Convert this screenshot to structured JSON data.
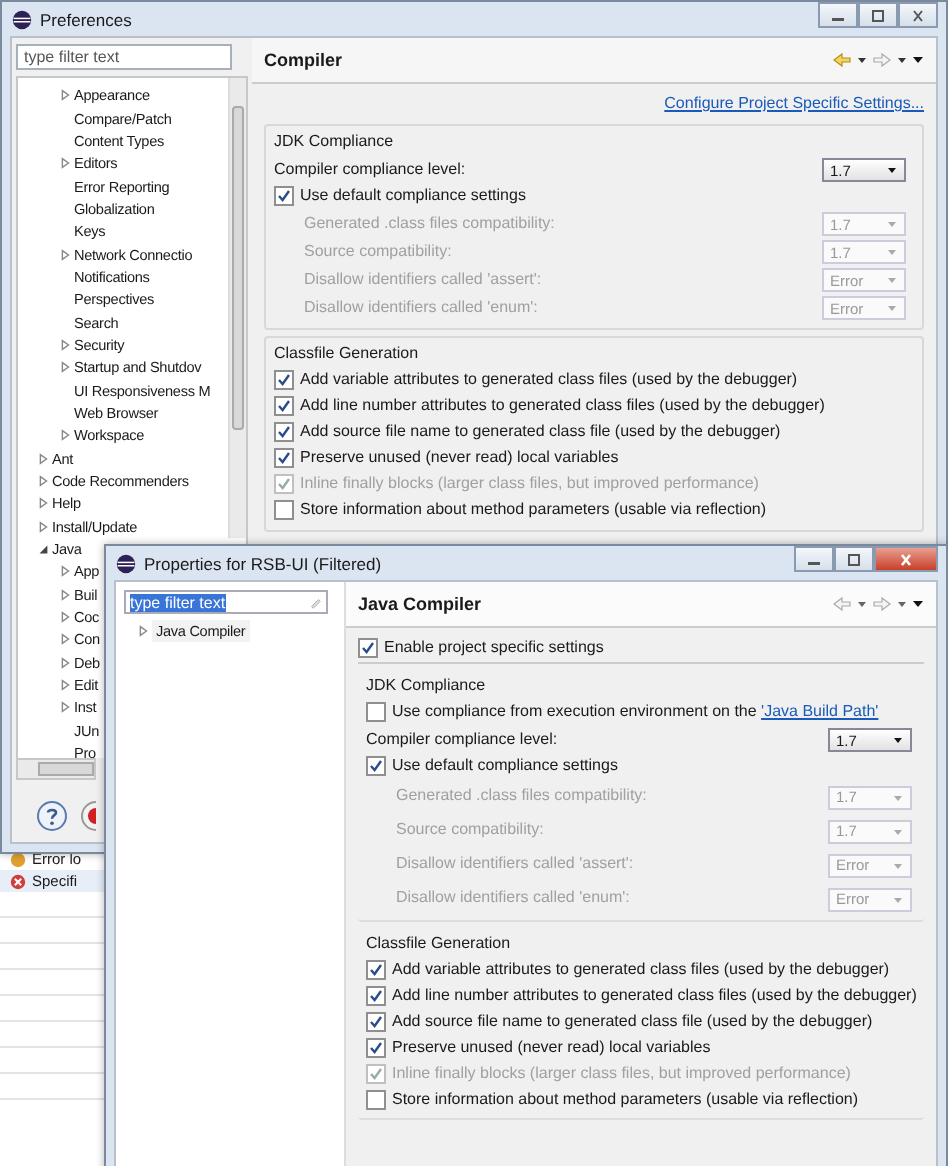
{
  "preferences": {
    "title": "Preferences",
    "filter": {
      "placeholder": "type filter text"
    },
    "tree": [
      {
        "children": [
          {
            "label": "Appearance",
            "expanded": false
          },
          {
            "label": "Compare/Patch"
          },
          {
            "label": "Content Types"
          },
          {
            "label": "Editors",
            "expanded": false
          },
          {
            "label": "Error Reporting"
          },
          {
            "label": "Globalization"
          },
          {
            "label": "Keys"
          },
          {
            "label": "Network Connectio",
            "expanded": false
          },
          {
            "label": "Notifications"
          },
          {
            "label": "Perspectives"
          },
          {
            "label": "Search"
          },
          {
            "label": "Security",
            "expanded": false
          },
          {
            "label": "Startup and Shutdov",
            "expanded": false
          },
          {
            "label": "UI Responsiveness M"
          },
          {
            "label": "Web Browser"
          },
          {
            "label": "Workspace",
            "expanded": false
          }
        ]
      },
      {
        "label": "Ant",
        "expanded": false
      },
      {
        "label": "Code Recommenders",
        "expanded": false
      },
      {
        "label": "Help",
        "expanded": false
      },
      {
        "label": "Install/Update",
        "expanded": false
      },
      {
        "label": "Java",
        "expanded": true,
        "children": [
          {
            "label": "App",
            "expanded": false
          },
          {
            "label": "Buil",
            "expanded": false
          },
          {
            "label": "Coc",
            "expanded": false
          },
          {
            "label": "Con",
            "expanded": false
          },
          {
            "label": "Deb",
            "expanded": false
          },
          {
            "label": "Edit",
            "expanded": false
          },
          {
            "label": "Inst",
            "expanded": false
          },
          {
            "label": "JUn"
          },
          {
            "label": "Pro"
          }
        ]
      }
    ],
    "page": {
      "title": "Compiler",
      "link": "Configure Project Specific Settings...",
      "jdk": {
        "heading": "JDK Compliance",
        "level_label": "Compiler compliance level:",
        "level_value": "1.7",
        "use_default": {
          "label": "Use default compliance settings",
          "checked": true
        },
        "rows": [
          {
            "label": "Generated .class files compatibility:",
            "value": "1.7",
            "disabled": true
          },
          {
            "label": "Source compatibility:",
            "value": "1.7",
            "disabled": true
          },
          {
            "label": "Disallow identifiers called 'assert':",
            "value": "Error",
            "disabled": true
          },
          {
            "label": "Disallow identifiers called 'enum':",
            "value": "Error",
            "disabled": true
          }
        ]
      },
      "classfile": {
        "heading": "Classfile Generation",
        "options": [
          {
            "label": "Add variable attributes to generated class files (used by the debugger)",
            "checked": true,
            "disabled": false
          },
          {
            "label": "Add line number attributes to generated class files (used by the debugger)",
            "checked": true,
            "disabled": false
          },
          {
            "label": "Add source file name to generated class file (used by the debugger)",
            "checked": true,
            "disabled": false
          },
          {
            "label": "Preserve unused (never read) local variables",
            "checked": true,
            "disabled": false
          },
          {
            "label": "Inline finally blocks (larger class files, but improved performance)",
            "checked": true,
            "disabled": true
          },
          {
            "label": "Store information about method parameters (usable via reflection)",
            "checked": false,
            "disabled": false
          }
        ]
      }
    }
  },
  "background_view": {
    "rows": [
      {
        "label": "Error lo",
        "kind": "warning"
      },
      {
        "label": "Specifi",
        "kind": "error"
      }
    ]
  },
  "properties": {
    "title": "Properties for RSB-UI (Filtered)",
    "filter": {
      "value": "type filter text",
      "text_selected": true
    },
    "tree": [
      {
        "label": "Java Compiler",
        "expanded": false
      }
    ],
    "page": {
      "title": "Java Compiler",
      "enable": {
        "label": "Enable project specific settings",
        "checked": true
      },
      "jdk": {
        "heading": "JDK Compliance",
        "use_ee": {
          "label": "Use compliance from execution environment on the ",
          "link": "'Java Build Path'",
          "checked": false
        },
        "level_label": "Compiler compliance level:",
        "level_value": "1.7",
        "use_default": {
          "label": "Use default compliance settings",
          "checked": true
        },
        "rows": [
          {
            "label": "Generated .class files compatibility:",
            "value": "1.7",
            "disabled": true
          },
          {
            "label": "Source compatibility:",
            "value": "1.7",
            "disabled": true
          },
          {
            "label": "Disallow identifiers called 'assert':",
            "value": "Error",
            "disabled": true
          },
          {
            "label": "Disallow identifiers called 'enum':",
            "value": "Error",
            "disabled": true
          }
        ]
      },
      "classfile": {
        "heading": "Classfile Generation",
        "options": [
          {
            "label": "Add variable attributes to generated class files (used by the debugger)",
            "checked": true,
            "disabled": false
          },
          {
            "label": "Add line number attributes to generated class files (used by the debugger)",
            "checked": true,
            "disabled": false
          },
          {
            "label": "Add source file name to generated class file (used by the debugger)",
            "checked": true,
            "disabled": false
          },
          {
            "label": "Preserve unused (never read) local variables",
            "checked": true,
            "disabled": false
          },
          {
            "label": "Inline finally blocks (larger class files, but improved performance)",
            "checked": true,
            "disabled": true
          },
          {
            "label": "Store information about method parameters (usable via reflection)",
            "checked": false,
            "disabled": false
          }
        ]
      }
    }
  }
}
